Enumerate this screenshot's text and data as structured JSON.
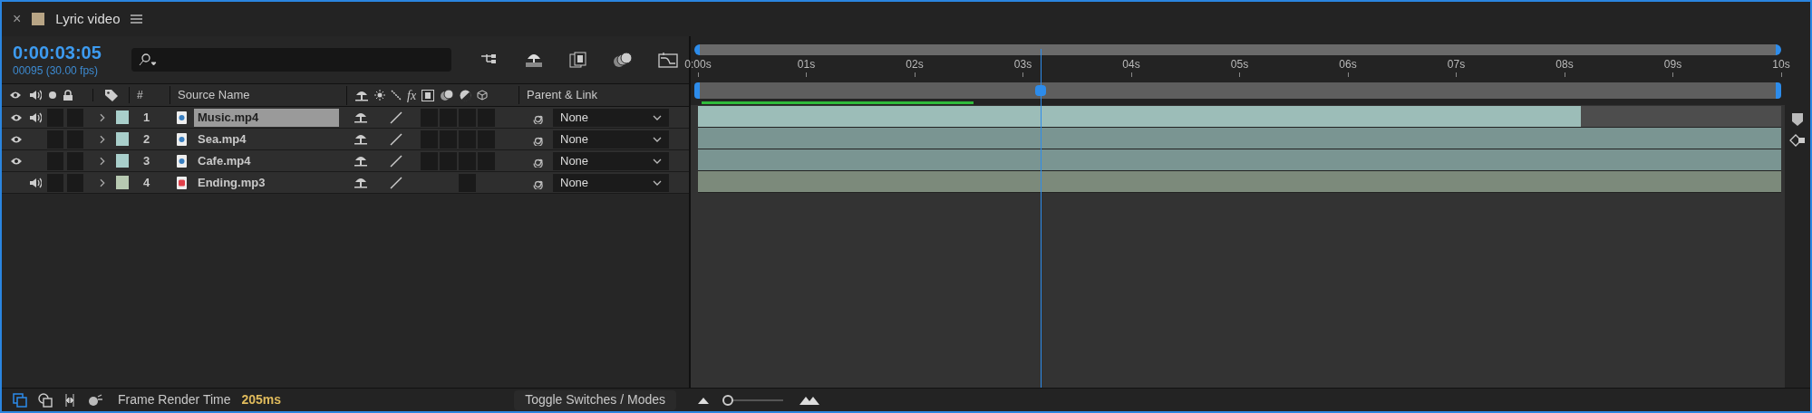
{
  "tab": {
    "close": "×",
    "title": "Lyric video"
  },
  "timecode": {
    "time": "0:00:03:05",
    "frames": "00095 (30.00 fps)"
  },
  "columns": {
    "fx": "fx",
    "number": "#",
    "source": "Source Name",
    "parent": "Parent & Link"
  },
  "ruler": {
    "ticks": [
      "0:00s",
      "01s",
      "02s",
      "03s",
      "04s",
      "05s",
      "06s",
      "07s",
      "08s",
      "09s",
      "10s"
    ]
  },
  "playhead": {
    "level": 0.3167
  },
  "layers": [
    {
      "number": "1",
      "name": "Music.mp4",
      "kind": "video",
      "video": true,
      "audio": true,
      "solo": false,
      "locked": false,
      "selected": true,
      "color": "#a9cfcb",
      "parent": "None",
      "level": 0.815
    },
    {
      "number": "2",
      "name": "Sea.mp4",
      "kind": "video",
      "video": true,
      "audio": false,
      "solo": false,
      "locked": false,
      "selected": false,
      "color": "#a9cfcb",
      "parent": "None",
      "level": 1
    },
    {
      "number": "3",
      "name": "Cafe.mp4",
      "kind": "video",
      "video": true,
      "audio": false,
      "solo": false,
      "locked": false,
      "selected": false,
      "color": "#a9cfcb",
      "parent": "None",
      "level": 1
    },
    {
      "number": "4",
      "name": "Ending.mp3",
      "kind": "audio",
      "video": false,
      "audio": true,
      "solo": false,
      "locked": false,
      "selected": false,
      "color": "#b7c9b1",
      "parent": "None",
      "level": 1
    }
  ],
  "status_bar": {
    "label": "Frame Render Time",
    "value": "205ms",
    "toggle": "Toggle Switches / Modes",
    "zoom": {
      "level": 0.12
    }
  }
}
